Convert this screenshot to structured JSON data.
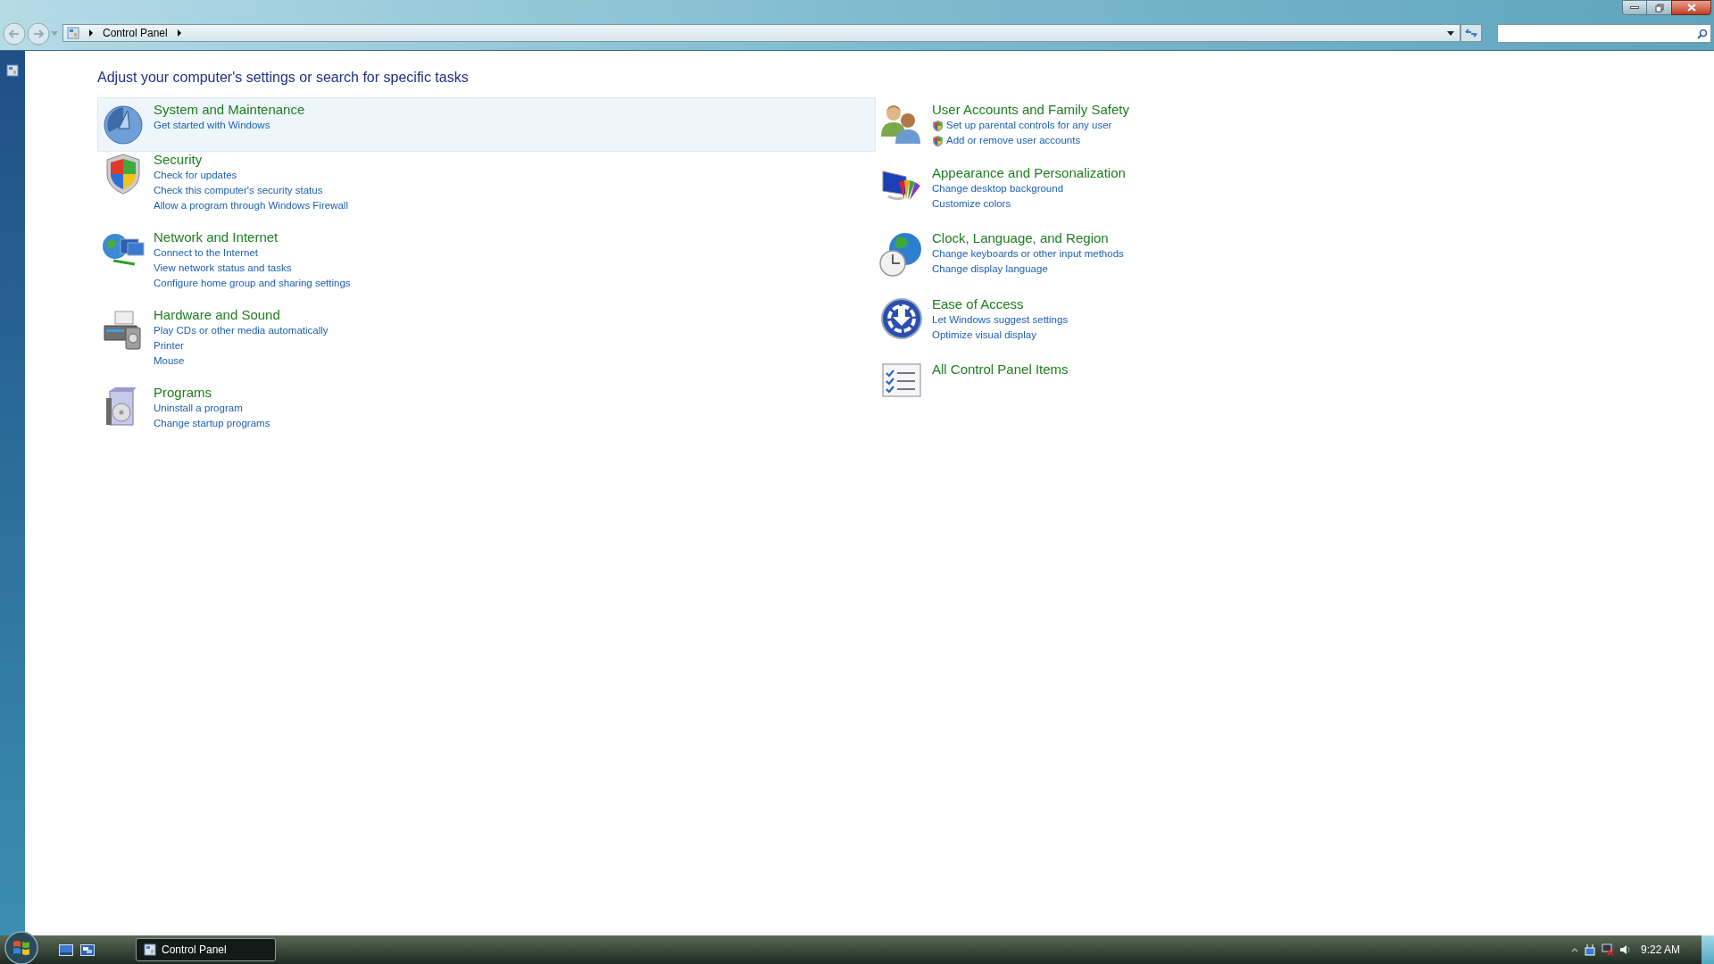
{
  "window": {
    "breadcrumb": [
      "Control Panel"
    ]
  },
  "heading": "Adjust your computer's settings or search for specific tasks",
  "left_column": [
    {
      "title": "System and Maintenance",
      "selected": true,
      "links": [
        {
          "label": "Get started with Windows"
        }
      ]
    },
    {
      "title": "Security",
      "selected": false,
      "links": [
        {
          "label": "Check for updates"
        },
        {
          "label": "Check this computer's security status"
        },
        {
          "label": "Allow a program through Windows Firewall"
        }
      ]
    },
    {
      "title": "Network and Internet",
      "selected": false,
      "links": [
        {
          "label": "Connect to the Internet"
        },
        {
          "label": "View network status and tasks"
        },
        {
          "label": "Configure home group and sharing settings"
        }
      ]
    },
    {
      "title": "Hardware and Sound",
      "selected": false,
      "links": [
        {
          "label": "Play CDs or other media automatically"
        },
        {
          "label": "Printer"
        },
        {
          "label": "Mouse"
        }
      ]
    },
    {
      "title": "Programs",
      "selected": false,
      "links": [
        {
          "label": "Uninstall a program"
        },
        {
          "label": "Change startup programs"
        }
      ]
    }
  ],
  "right_column": [
    {
      "title": "User Accounts and Family Safety",
      "selected": false,
      "links": [
        {
          "label": "Set up parental controls for any user",
          "shield": true
        },
        {
          "label": "Add or remove user accounts",
          "shield": true
        }
      ]
    },
    {
      "title": "Appearance and Personalization",
      "selected": false,
      "links": [
        {
          "label": "Change desktop background"
        },
        {
          "label": "Customize colors"
        }
      ]
    },
    {
      "title": "Clock, Language, and Region",
      "selected": false,
      "links": [
        {
          "label": "Change keyboards or other input methods"
        },
        {
          "label": "Change display language"
        }
      ]
    },
    {
      "title": "Ease of Access",
      "selected": false,
      "links": [
        {
          "label": "Let Windows suggest settings"
        },
        {
          "label": "Optimize visual display"
        }
      ]
    },
    {
      "title": "All Control Panel Items",
      "selected": false
    }
  ],
  "taskbar": {
    "tasks": [
      {
        "label": "Control Panel",
        "selected": true
      }
    ],
    "clock": "9:22 AM"
  }
}
